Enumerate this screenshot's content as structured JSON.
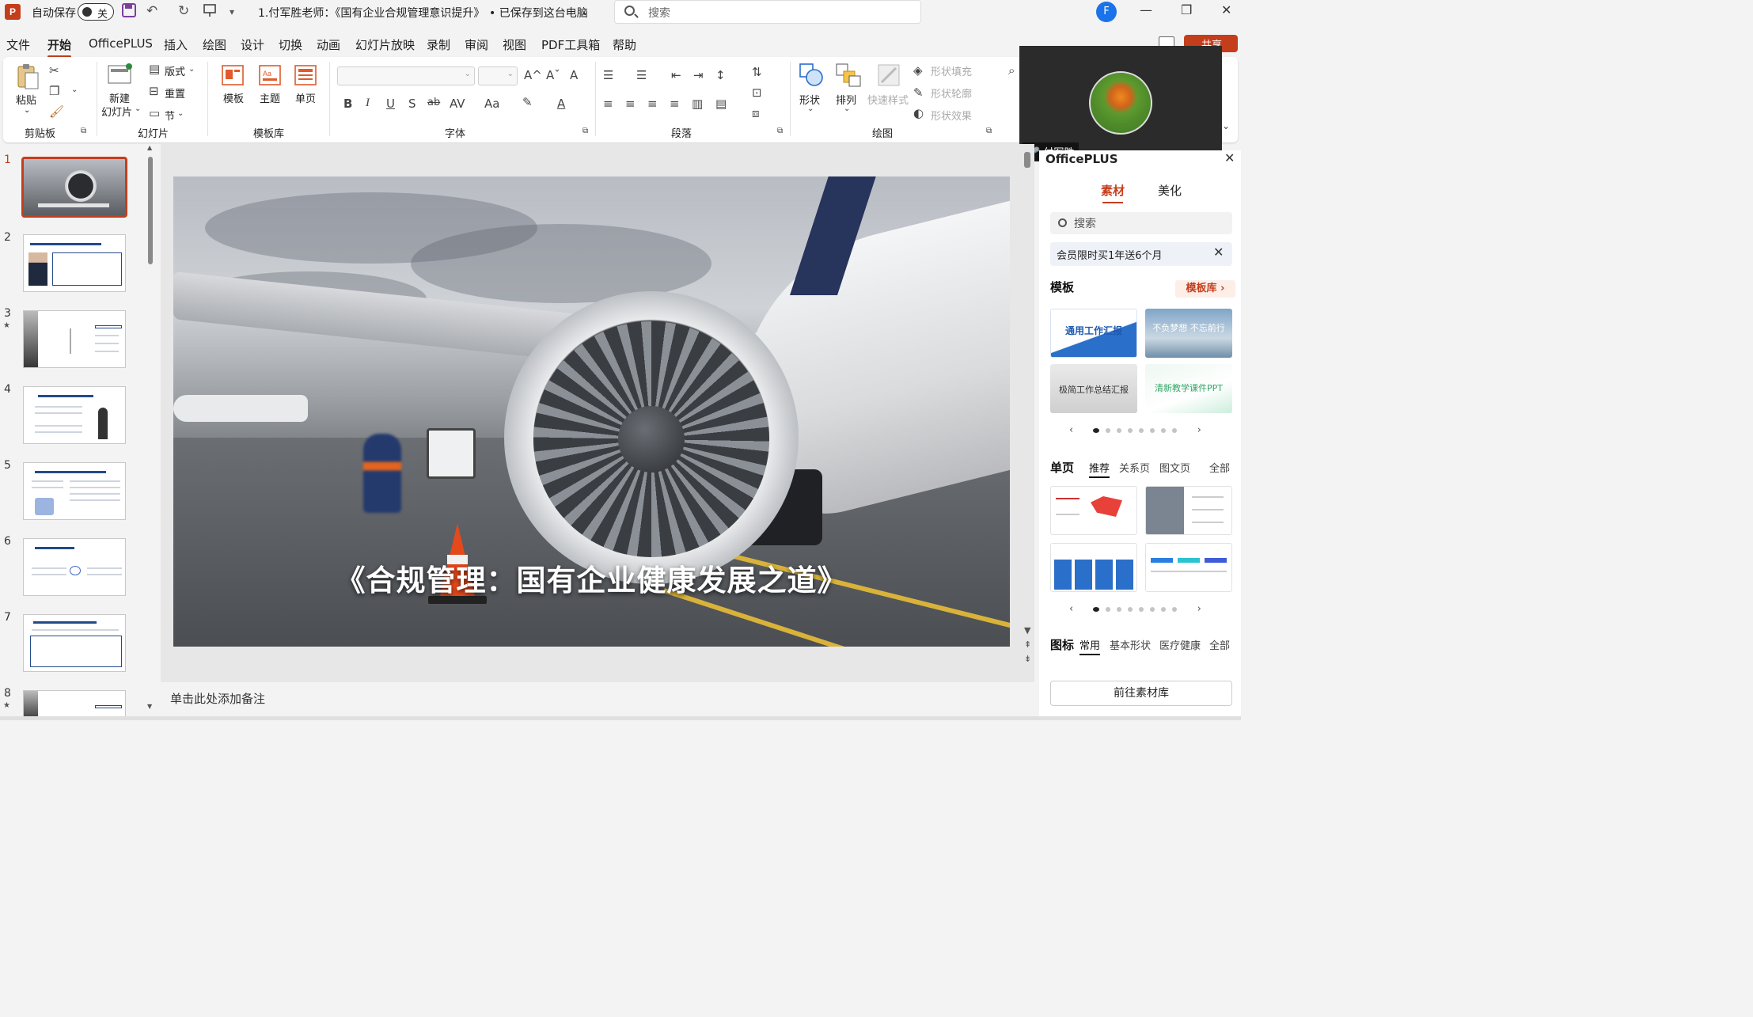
{
  "titlebar": {
    "logo": "P",
    "autosave_label": "自动保存",
    "autosave_state": "关",
    "doc_title": "1.付军胜老师：《国有企业合规管理意识提升》...",
    "saved_status": "• 已保存到这台电脑",
    "search_placeholder": "搜索",
    "user_initial": "F",
    "minimize": "—",
    "restore": "❐",
    "close": "✕"
  },
  "menu": [
    "文件",
    "开始",
    "OfficePLUS",
    "插入",
    "绘图",
    "设计",
    "切换",
    "动画",
    "幻灯片放映",
    "录制",
    "审阅",
    "视图",
    "PDF工具箱",
    "帮助"
  ],
  "menu_active": "开始",
  "share_label": "共享",
  "ribbon": {
    "clipboard": {
      "paste": "粘贴",
      "group": "剪贴板"
    },
    "slides": {
      "new_slide_1": "新建",
      "new_slide_2": "幻灯片",
      "layout": "版式",
      "reset": "重置",
      "section": "节",
      "group": "幻灯片"
    },
    "template_lib": {
      "template": "模板",
      "theme": "主题",
      "single": "单页",
      "group": "模板库"
    },
    "font": {
      "group": "字体",
      "bold": "B",
      "italic": "I",
      "underline": "U",
      "shadow": "S",
      "strike": "ab",
      "spacing": "AV",
      "case": "Aa",
      "grow": "A^",
      "shrink": "Aˇ",
      "clear": "A"
    },
    "paragraph": {
      "group": "段落"
    },
    "drawing": {
      "shape": "形状",
      "arrange": "排列",
      "quick_style": "快速样式",
      "fill": "形状填充",
      "outline": "形状轮廓",
      "effect": "形状效果",
      "group": "绘图"
    }
  },
  "video": {
    "name": "付军胜"
  },
  "slides": [
    {
      "num": "1",
      "selected": true,
      "star": false
    },
    {
      "num": "2",
      "selected": false,
      "star": false
    },
    {
      "num": "3",
      "selected": false,
      "star": true
    },
    {
      "num": "4",
      "selected": false,
      "star": false
    },
    {
      "num": "5",
      "selected": false,
      "star": false
    },
    {
      "num": "6",
      "selected": false,
      "star": false
    },
    {
      "num": "7",
      "selected": false,
      "star": false
    },
    {
      "num": "8",
      "selected": false,
      "star": true
    }
  ],
  "slide_title": "《合规管理：国有企业健康发展之道》",
  "notes_placeholder": "单击此处添加备注",
  "rpane": {
    "title": "OfficePLUS",
    "tabs": [
      "素材",
      "美化"
    ],
    "search_placeholder": "搜索",
    "promo": "会员限时买1年送6个月",
    "template_head": "模板",
    "template_lib": "模板库",
    "template_cards": [
      "通用工作汇报",
      "不负梦想 不忘前行",
      "极简工作总结汇报",
      "清新教学课件PPT"
    ],
    "single_head": "单页",
    "single_tabs": [
      "推荐",
      "关系页",
      "图文页",
      "全部"
    ],
    "icon_head": "图标",
    "icon_tabs": [
      "常用",
      "基本形状",
      "医疗健康",
      "全部"
    ],
    "go_button": "前往素材库"
  }
}
